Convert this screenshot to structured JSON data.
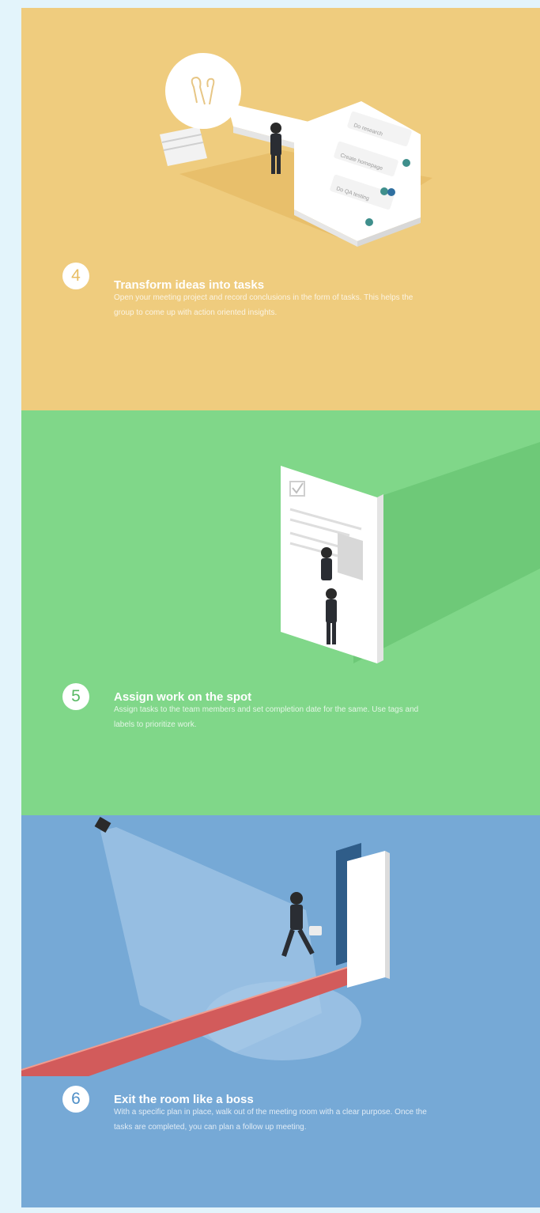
{
  "steps": [
    {
      "number": "4",
      "title": "Transform ideas into tasks",
      "description": "Open your meeting project and record conclusions in the form of tasks. This helps the group to come up with action oriented insights.",
      "checklist": [
        "Do research",
        "Create homepage",
        "Do QA testing"
      ],
      "color": "#efcc7e"
    },
    {
      "number": "5",
      "title": "Assign work on the spot",
      "description": "Assign tasks to the team members and set completion date for the same. Use tags and labels to prioritize work.",
      "color": "#80d789"
    },
    {
      "number": "6",
      "title": "Exit the room like a boss",
      "description": "With a specific plan in place, walk out of the meeting room with a clear purpose. Once the tasks are completed, you can plan a follow up meeting.",
      "color": "#76a9d6"
    }
  ]
}
